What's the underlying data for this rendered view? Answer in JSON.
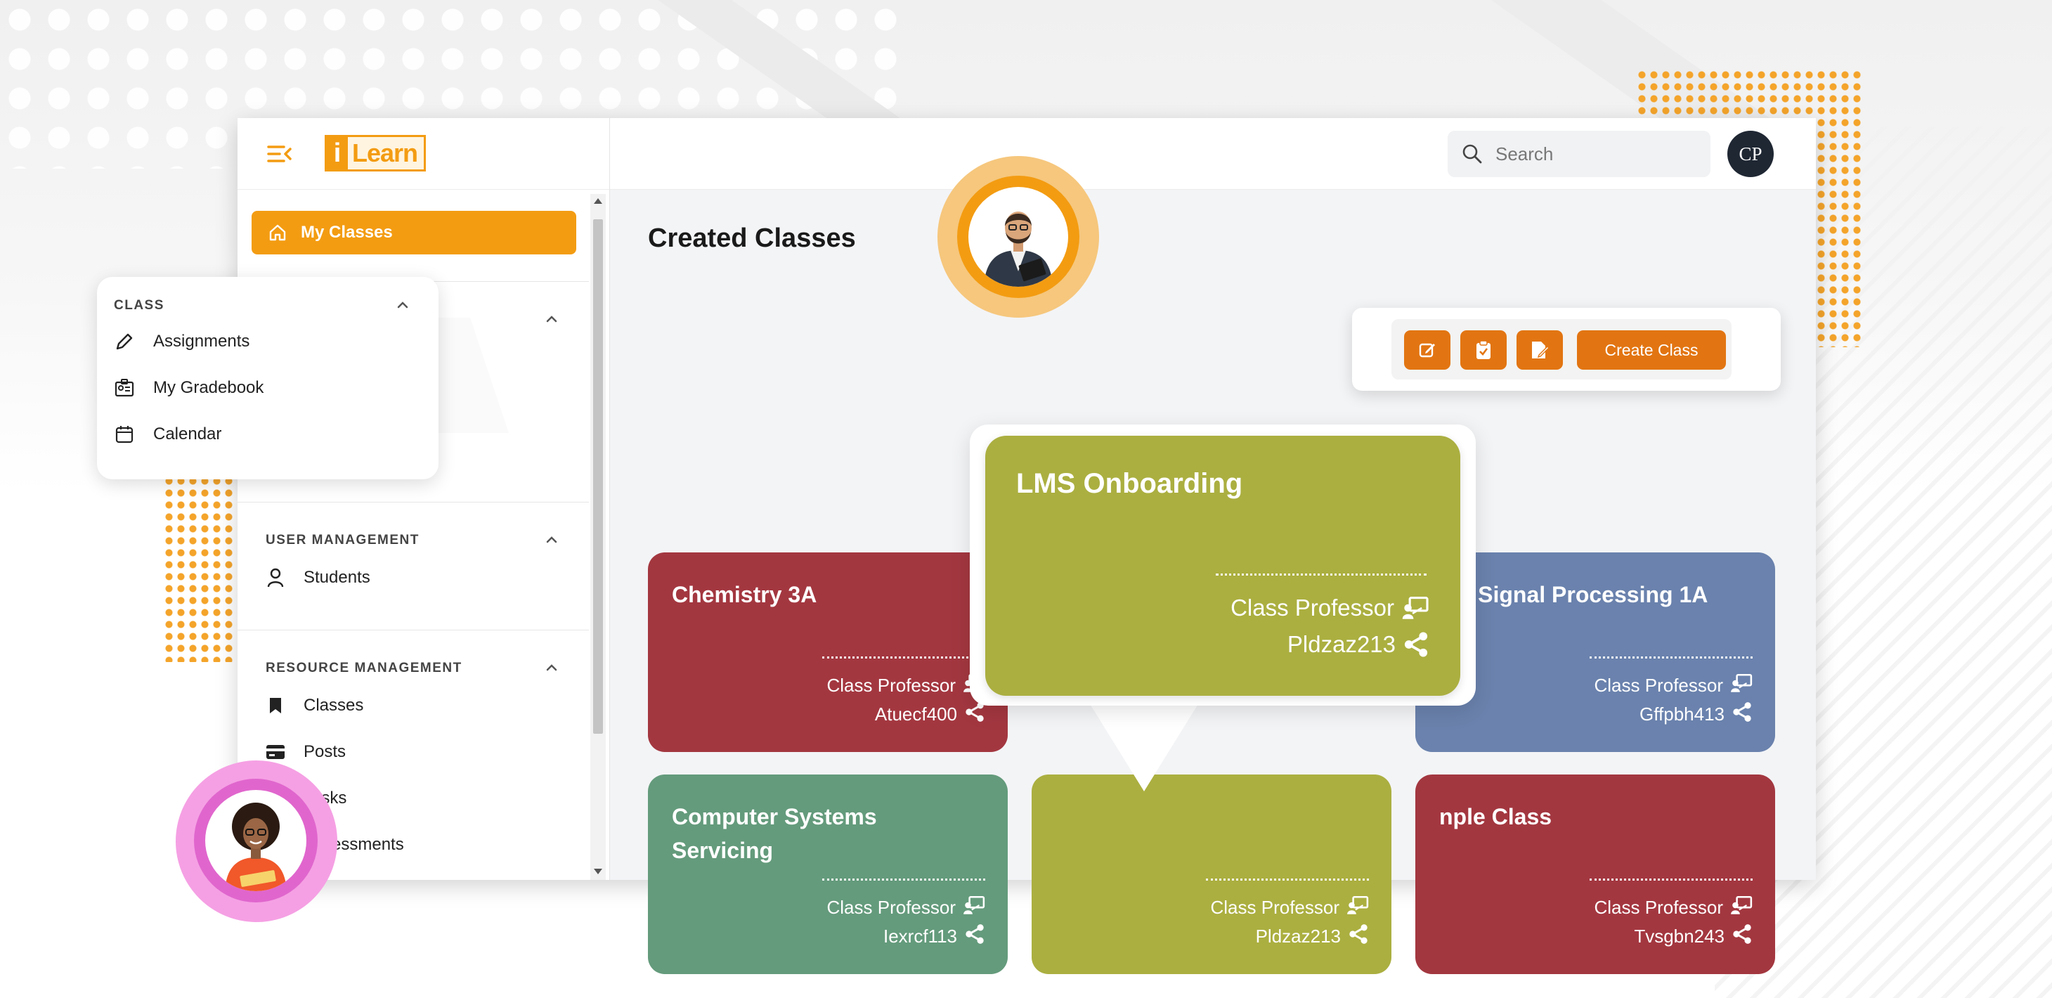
{
  "app": {
    "logo_mark": "i",
    "logo_text": "Learn"
  },
  "sidebar": {
    "active_item": {
      "label": "My Classes",
      "icon": "home-icon"
    },
    "class_section": {
      "title": "CLASS",
      "items": [
        {
          "label": "Assignments",
          "icon": "pencil-icon"
        },
        {
          "label": "My Gradebook",
          "icon": "gradebook-icon"
        },
        {
          "label": "Calendar",
          "icon": "calendar-icon"
        }
      ]
    },
    "user_management": {
      "title": "USER MANAGEMENT",
      "items": [
        {
          "label": "Students",
          "icon": "user-icon"
        }
      ]
    },
    "resource_management": {
      "title": "RESOURCE MANAGEMENT",
      "items": [
        {
          "label": "Classes",
          "icon": "bookmark-icon"
        },
        {
          "label": "Posts",
          "icon": "card-icon"
        },
        {
          "label": "Tasks",
          "icon": "task-icon"
        },
        {
          "label": "Assessments",
          "icon": "assessment-icon"
        }
      ]
    }
  },
  "topbar": {
    "search_placeholder": "Search",
    "user_initials": "CP"
  },
  "main": {
    "title": "Created Classes",
    "toolbar": {
      "icon_buttons": [
        "edit-icon",
        "clipboard-check-icon",
        "document-edit-icon"
      ],
      "create_label": "Create Class"
    },
    "cards": [
      {
        "title": "Chemistry 3A",
        "role": "Class Professor",
        "code": "Atuecf400",
        "color": "#a33740"
      },
      {
        "title": "ital Signal Processing 1A",
        "role": "Class Professor",
        "code": "Gffpbh413",
        "color": "#6a82ad"
      },
      {
        "title": "Computer Systems Servicing",
        "role": "Class Professor",
        "code": "Iexrcf113",
        "color": "#649b7c"
      },
      {
        "title": "",
        "role": "Class Professor",
        "code": "Pldzaz213",
        "color": "#abaf40"
      },
      {
        "title": "nple Class",
        "role": "Class Professor",
        "code": "Tvsgbn243",
        "color": "#a33740"
      }
    ],
    "popup_card": {
      "title": "LMS Onboarding",
      "role": "Class Professor",
      "code": "Pldzaz213",
      "color": "#abaf40"
    }
  },
  "colors": {
    "accent": "#f39c12",
    "button": "#e27512",
    "avatar_bg": "#1f2733"
  }
}
